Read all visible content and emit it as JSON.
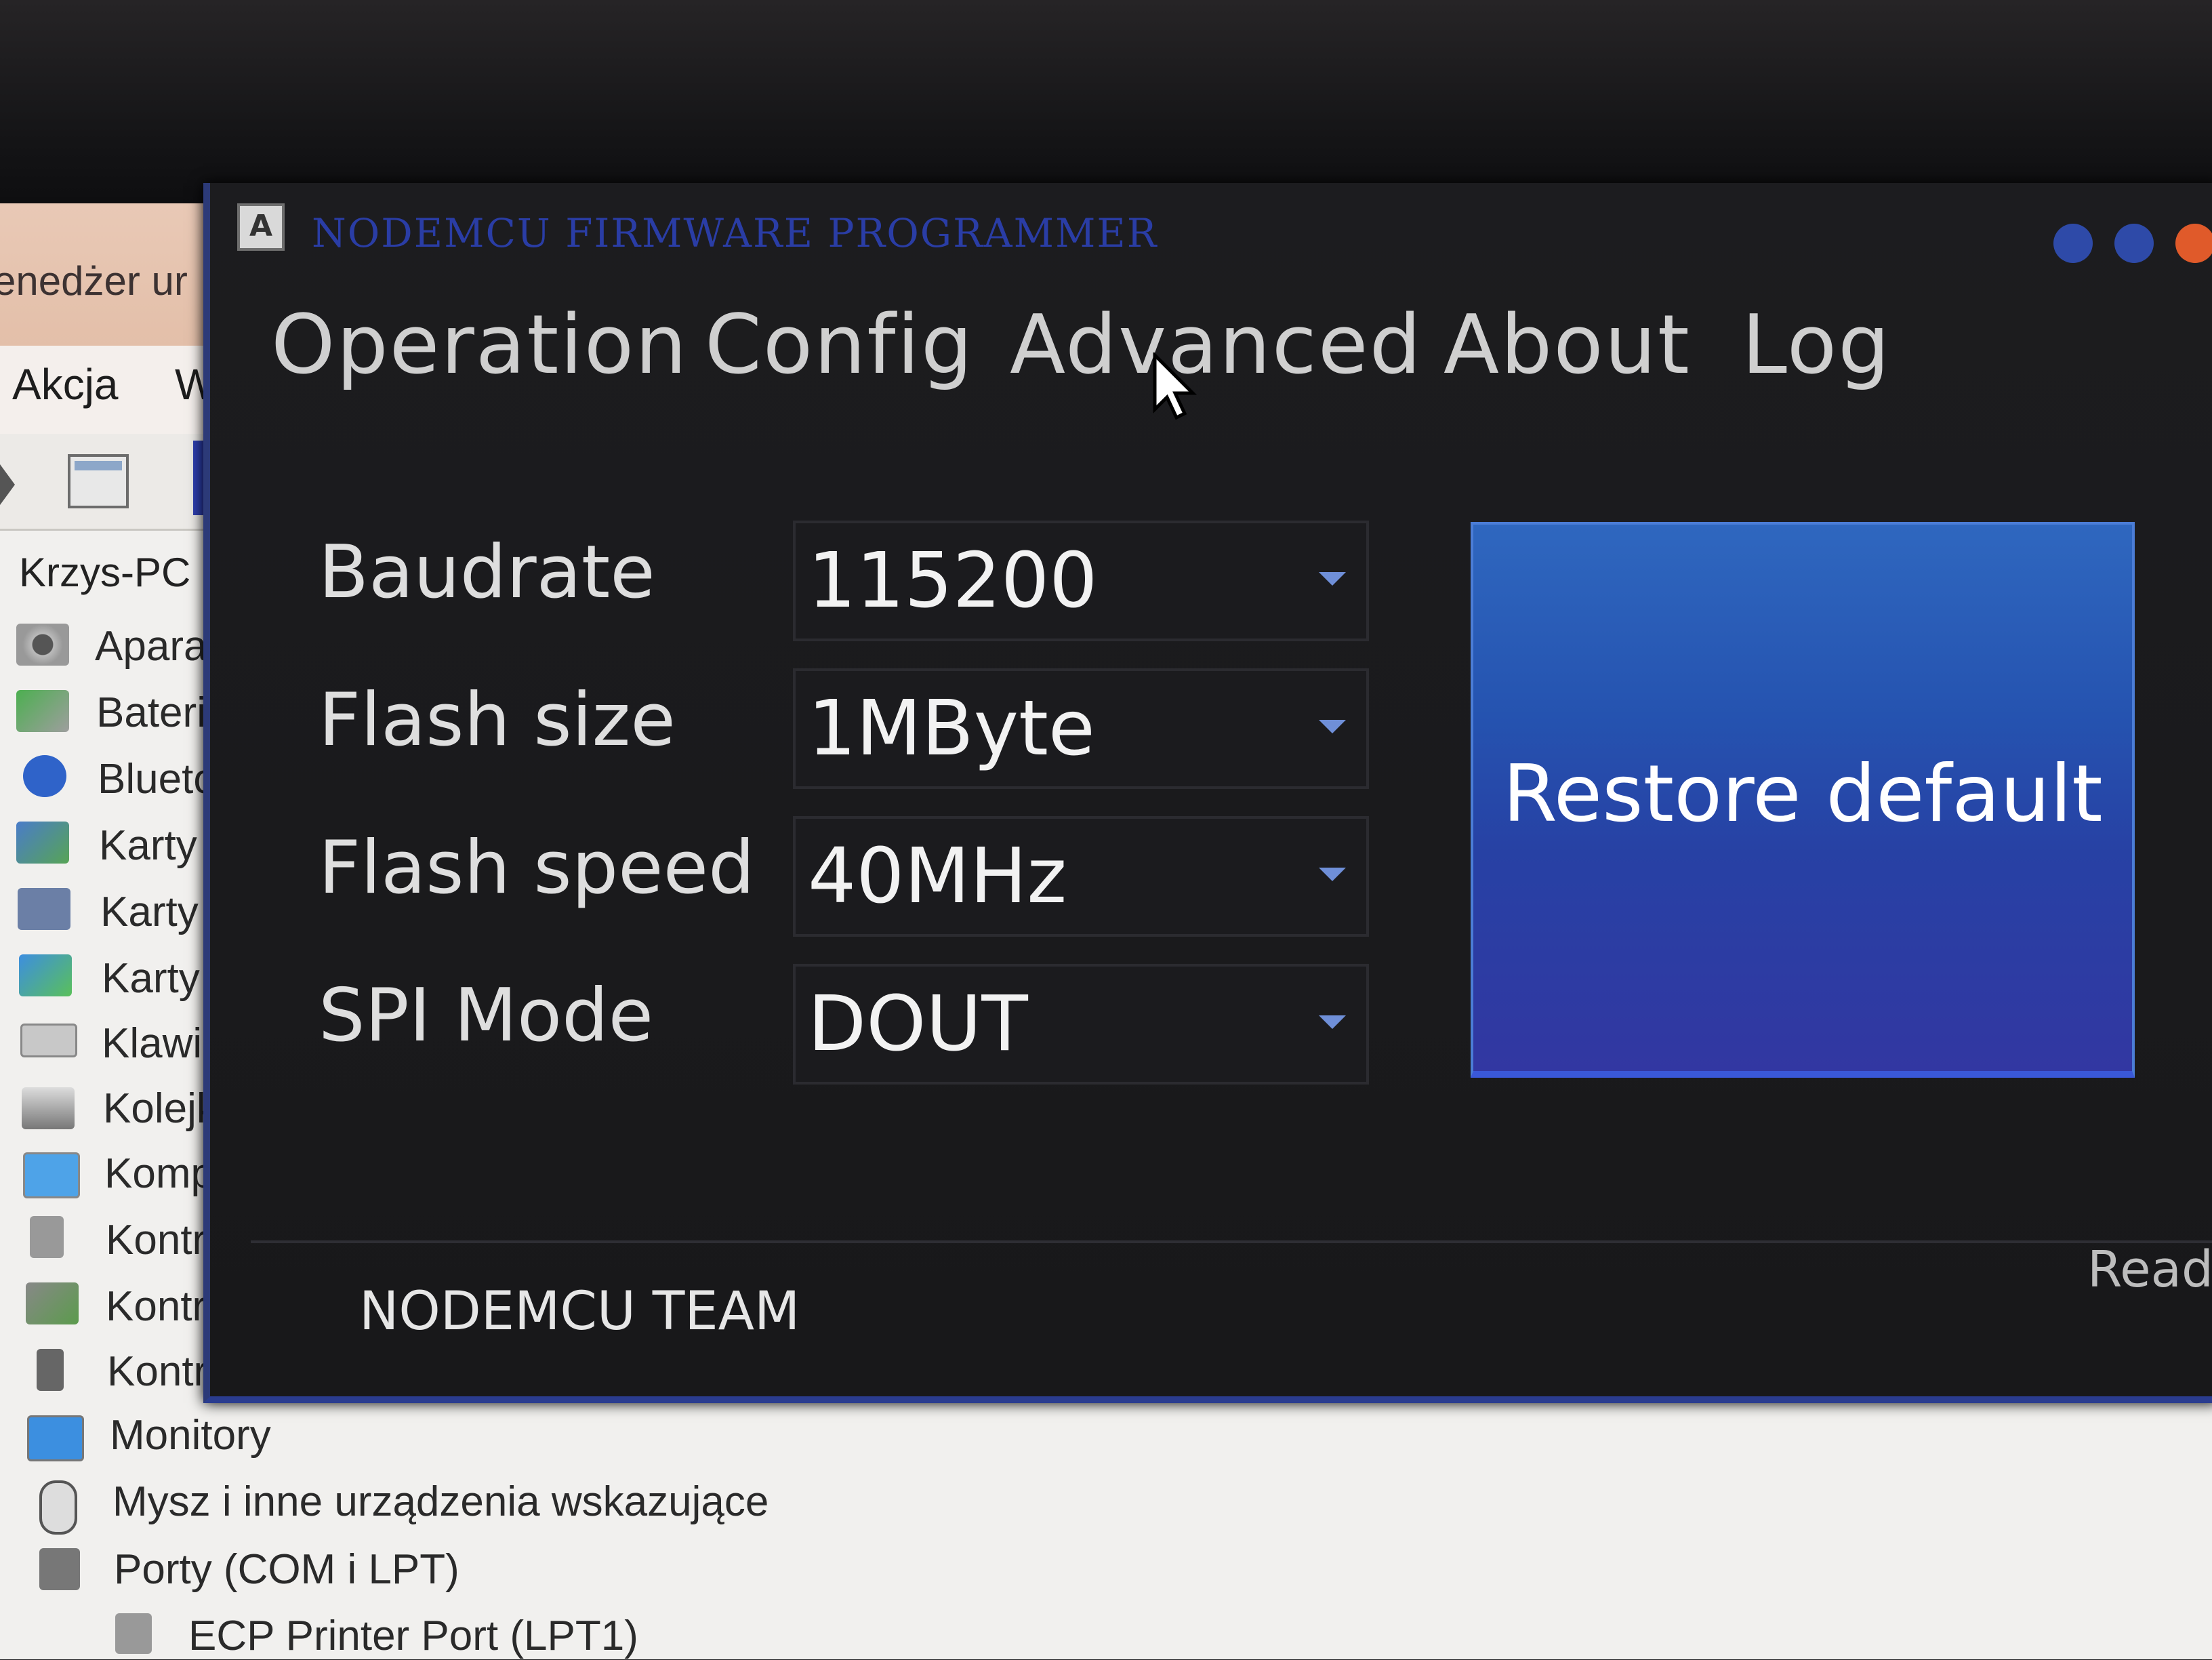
{
  "device_manager": {
    "title_fragment": "enedżer ur",
    "menu": [
      {
        "label": "Akcja"
      },
      {
        "label": "W"
      }
    ],
    "tree_root": "Krzys-PC",
    "tree_items": [
      {
        "label": "Apara"
      },
      {
        "label": "Bateri"
      },
      {
        "label": "Blueto"
      },
      {
        "label": "Karty"
      },
      {
        "label": "Karty"
      },
      {
        "label": "Karty"
      },
      {
        "label": "Klawia"
      },
      {
        "label": "Kolejk"
      },
      {
        "label": "Komp"
      },
      {
        "label": "Kontr"
      },
      {
        "label": "Kontr"
      },
      {
        "label": "Kontr"
      },
      {
        "label": "Monitory"
      },
      {
        "label": "Mysz i inne urządzenia wskazujące"
      },
      {
        "label": "Porty (COM i LPT)"
      },
      {
        "label": "ECP Printer Port (LPT1)"
      }
    ]
  },
  "nodemcu": {
    "title": "NODEMCU FIRMWARE PROGRAMMER",
    "menu": [
      {
        "label": "Operation"
      },
      {
        "label": "Config"
      },
      {
        "label": "Advanced"
      },
      {
        "label": "About"
      },
      {
        "label": "Log"
      }
    ],
    "settings": [
      {
        "label": "Baudrate",
        "value": "115200"
      },
      {
        "label": "Flash size",
        "value": "1MByte"
      },
      {
        "label": "Flash speed",
        "value": "40MHz"
      },
      {
        "label": "SPI Mode",
        "value": "DOUT"
      }
    ],
    "restore_button": "Restore default",
    "footer": "NODEMCU TEAM",
    "status": "Ready",
    "colors": {
      "accent": "#2b4fb3",
      "background": "#1b1b1d",
      "text": "#dedede"
    }
  }
}
